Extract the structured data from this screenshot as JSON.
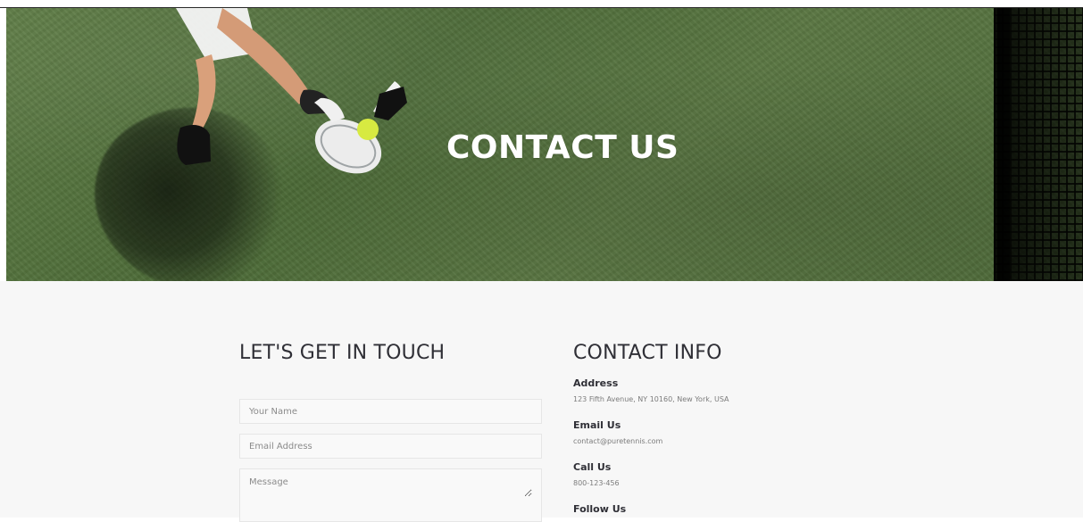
{
  "hero": {
    "title": "CONTACT US"
  },
  "form": {
    "title": "LET'S GET IN TOUCH",
    "name_placeholder": "Your Name",
    "email_placeholder": "Email Address",
    "message_placeholder": "Message"
  },
  "contact": {
    "title": "CONTACT INFO",
    "items": [
      {
        "label": "Address",
        "value": "123 Fifth Avenue, NY 10160, New York, USA"
      },
      {
        "label": "Email Us",
        "value": "contact@puretennis.com"
      },
      {
        "label": "Call Us",
        "value": "800-123-456"
      },
      {
        "label": "Follow Us",
        "value": ""
      }
    ]
  },
  "colors": {
    "hero_green": "#5b7743",
    "content_background": "#f7f7f7",
    "heading_text": "#2f2f36",
    "body_text": "#7c7c7c"
  }
}
